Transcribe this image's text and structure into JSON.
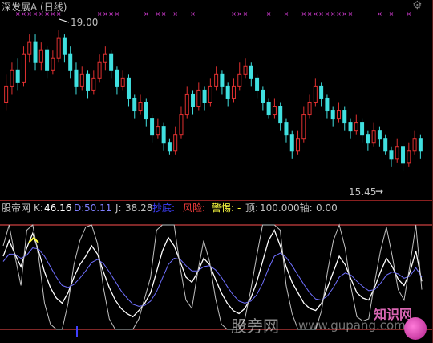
{
  "header": {
    "title": "深发展A (日线)",
    "icon": "gear-icon"
  },
  "price_labels": {
    "high": "19.00",
    "low": "15.45"
  },
  "indicator_bar": {
    "name": "股帝网",
    "k_label": "K:",
    "k_value": "46.16",
    "d_label": "D:",
    "d_value": "50.11",
    "j_label": "J:",
    "j_value": "38.28",
    "buy_label": "抄底:",
    "risk_label": "风险:",
    "alert_label": "警惕:",
    "alert_value": "-",
    "top_label": "顶:",
    "top_value": "100.00",
    "zero_label": "0轴:",
    "zero_value": "0.00"
  },
  "watermark": {
    "left": "股旁网",
    "right": "www.gupang.com",
    "logo": "知识网"
  },
  "colors": {
    "background": "#000000",
    "up_candle": "#e03030",
    "down_candle": "#40e0e0",
    "signal_marker": "#e040e0",
    "k_line": "#ffffff",
    "d_line": "#7070ff",
    "j_line": "#c0c0c0",
    "top_line": "#ff5050",
    "zero_line": "#ff5050",
    "text_label": "#c0c0c0",
    "k_text": "#ffffff",
    "d_text": "#8080ff",
    "buy_text": "#4040ff",
    "risk_text": "#ff4040",
    "alert_text": "#ffff40"
  },
  "chart_data": [
    {
      "type": "candlestick",
      "title": "深发展A (日线)",
      "high_price": 19.0,
      "low_price": 15.45,
      "ylim": [
        15.0,
        19.3
      ],
      "candles": [
        [
          17.2,
          17.6,
          17.9,
          17.0
        ],
        [
          17.6,
          18.0,
          18.2,
          17.4
        ],
        [
          18.0,
          17.7,
          18.3,
          17.5
        ],
        [
          17.7,
          18.4,
          18.6,
          17.6
        ],
        [
          18.4,
          18.7,
          18.9,
          18.2
        ],
        [
          18.7,
          18.2,
          18.9,
          18.0
        ],
        [
          18.2,
          18.5,
          18.7,
          18.0
        ],
        [
          18.5,
          18.0,
          18.6,
          17.8
        ],
        [
          18.0,
          18.3,
          18.5,
          17.9
        ],
        [
          18.3,
          18.8,
          19.0,
          18.2
        ],
        [
          18.8,
          18.4,
          18.9,
          18.2
        ],
        [
          18.4,
          18.0,
          18.6,
          17.8
        ],
        [
          18.0,
          17.6,
          18.2,
          17.4
        ],
        [
          17.6,
          17.9,
          18.1,
          17.5
        ],
        [
          17.9,
          17.5,
          18.0,
          17.3
        ],
        [
          17.5,
          17.8,
          18.0,
          17.4
        ],
        [
          17.8,
          18.2,
          18.4,
          17.7
        ],
        [
          18.2,
          18.4,
          18.6,
          18.0
        ],
        [
          18.4,
          18.0,
          18.5,
          17.8
        ],
        [
          18.0,
          17.6,
          18.1,
          17.4
        ],
        [
          17.6,
          17.8,
          18.0,
          17.5
        ],
        [
          17.8,
          17.3,
          17.9,
          17.1
        ],
        [
          17.3,
          17.0,
          17.4,
          16.8
        ],
        [
          17.0,
          17.2,
          17.4,
          16.9
        ],
        [
          17.2,
          16.8,
          17.3,
          16.6
        ],
        [
          16.8,
          16.4,
          16.9,
          16.2
        ],
        [
          16.4,
          16.6,
          16.8,
          16.3
        ],
        [
          16.6,
          16.2,
          16.7,
          16.0
        ],
        [
          16.2,
          16.0,
          16.3,
          15.9
        ],
        [
          16.0,
          16.4,
          16.6,
          15.9
        ],
        [
          16.4,
          16.9,
          17.1,
          16.3
        ],
        [
          16.9,
          17.4,
          17.6,
          16.8
        ],
        [
          17.4,
          17.1,
          17.5,
          16.9
        ],
        [
          17.1,
          17.5,
          17.7,
          17.0
        ],
        [
          17.5,
          17.2,
          17.6,
          17.0
        ],
        [
          17.2,
          17.6,
          17.8,
          17.1
        ],
        [
          17.6,
          17.9,
          18.1,
          17.5
        ],
        [
          17.9,
          17.6,
          18.0,
          17.4
        ],
        [
          17.6,
          17.3,
          17.7,
          17.1
        ],
        [
          17.3,
          17.6,
          17.8,
          17.2
        ],
        [
          17.6,
          17.9,
          18.2,
          17.5
        ],
        [
          17.9,
          18.1,
          18.3,
          17.8
        ],
        [
          18.1,
          17.8,
          18.2,
          17.6
        ],
        [
          17.8,
          17.5,
          17.9,
          17.3
        ],
        [
          17.5,
          17.2,
          17.6,
          17.0
        ],
        [
          17.2,
          16.9,
          17.3,
          16.8
        ],
        [
          16.9,
          17.1,
          17.3,
          16.8
        ],
        [
          17.1,
          16.7,
          17.2,
          16.5
        ],
        [
          16.7,
          16.4,
          16.8,
          16.2
        ],
        [
          16.4,
          16.0,
          16.5,
          15.8
        ],
        [
          16.0,
          16.3,
          16.5,
          15.9
        ],
        [
          16.3,
          16.9,
          17.1,
          16.2
        ],
        [
          16.9,
          17.2,
          17.4,
          16.8
        ],
        [
          17.2,
          17.6,
          17.8,
          17.1
        ],
        [
          17.6,
          17.3,
          17.7,
          17.1
        ],
        [
          17.3,
          17.0,
          17.4,
          16.8
        ],
        [
          17.0,
          16.8,
          17.1,
          16.6
        ],
        [
          16.8,
          17.0,
          17.2,
          16.7
        ],
        [
          17.0,
          16.7,
          17.1,
          16.5
        ],
        [
          16.7,
          16.5,
          16.8,
          16.3
        ],
        [
          16.5,
          16.7,
          16.9,
          16.4
        ],
        [
          16.7,
          16.4,
          16.8,
          16.2
        ],
        [
          16.4,
          16.2,
          16.5,
          16.0
        ],
        [
          16.2,
          16.5,
          16.7,
          16.1
        ],
        [
          16.5,
          16.3,
          16.6,
          16.1
        ],
        [
          16.3,
          16.0,
          16.4,
          15.9
        ],
        [
          16.0,
          15.8,
          16.1,
          15.6
        ],
        [
          15.8,
          16.1,
          16.3,
          15.7
        ],
        [
          16.1,
          15.7,
          16.2,
          15.5
        ],
        [
          15.7,
          16.0,
          16.2,
          15.6
        ],
        [
          16.0,
          16.3,
          16.5,
          15.9
        ],
        [
          16.3,
          16.0,
          16.4,
          15.8
        ]
      ]
    },
    {
      "type": "line",
      "ylim": [
        0,
        100
      ],
      "series": [
        {
          "name": "K",
          "values": [
            70,
            85,
            72,
            60,
            78,
            92,
            75,
            55,
            40,
            30,
            25,
            35,
            50,
            62,
            70,
            80,
            72,
            55,
            40,
            28,
            20,
            15,
            12,
            18,
            25,
            35,
            55,
            75,
            88,
            80,
            65,
            50,
            45,
            55,
            68,
            62,
            48,
            35,
            25,
            18,
            15,
            20,
            30,
            45,
            65,
            85,
            95,
            80,
            60,
            45,
            35,
            25,
            20,
            18,
            25,
            40,
            55,
            70,
            62,
            48,
            35,
            30,
            28,
            40,
            55,
            68,
            60,
            48,
            42,
            55,
            75,
            46
          ]
        },
        {
          "name": "D",
          "values": [
            65,
            72,
            72,
            68,
            71,
            78,
            77,
            70,
            60,
            50,
            42,
            40,
            43,
            49,
            56,
            64,
            67,
            63,
            55,
            46,
            37,
            30,
            24,
            22,
            23,
            27,
            36,
            49,
            62,
            68,
            67,
            61,
            56,
            56,
            60,
            61,
            57,
            50,
            41,
            33,
            27,
            25,
            27,
            33,
            44,
            58,
            70,
            73,
            69,
            61,
            52,
            43,
            35,
            29,
            28,
            32,
            40,
            50,
            54,
            52,
            46,
            41,
            37,
            38,
            44,
            52,
            55,
            53,
            49,
            51,
            59,
            50
          ]
        },
        {
          "name": "J",
          "values": [
            80,
            100,
            70,
            42,
            95,
            100,
            70,
            25,
            5,
            0,
            0,
            25,
            62,
            85,
            98,
            100,
            82,
            40,
            10,
            0,
            0,
            0,
            0,
            10,
            30,
            50,
            95,
            100,
            100,
            100,
            60,
            28,
            20,
            55,
            85,
            65,
            30,
            5,
            0,
            0,
            0,
            10,
            38,
            70,
            100,
            100,
            100,
            95,
            42,
            15,
            0,
            0,
            0,
            0,
            18,
            55,
            85,
            100,
            78,
            40,
            12,
            8,
            10,
            45,
            75,
            98,
            70,
            38,
            28,
            62,
            100,
            38
          ]
        }
      ]
    }
  ]
}
